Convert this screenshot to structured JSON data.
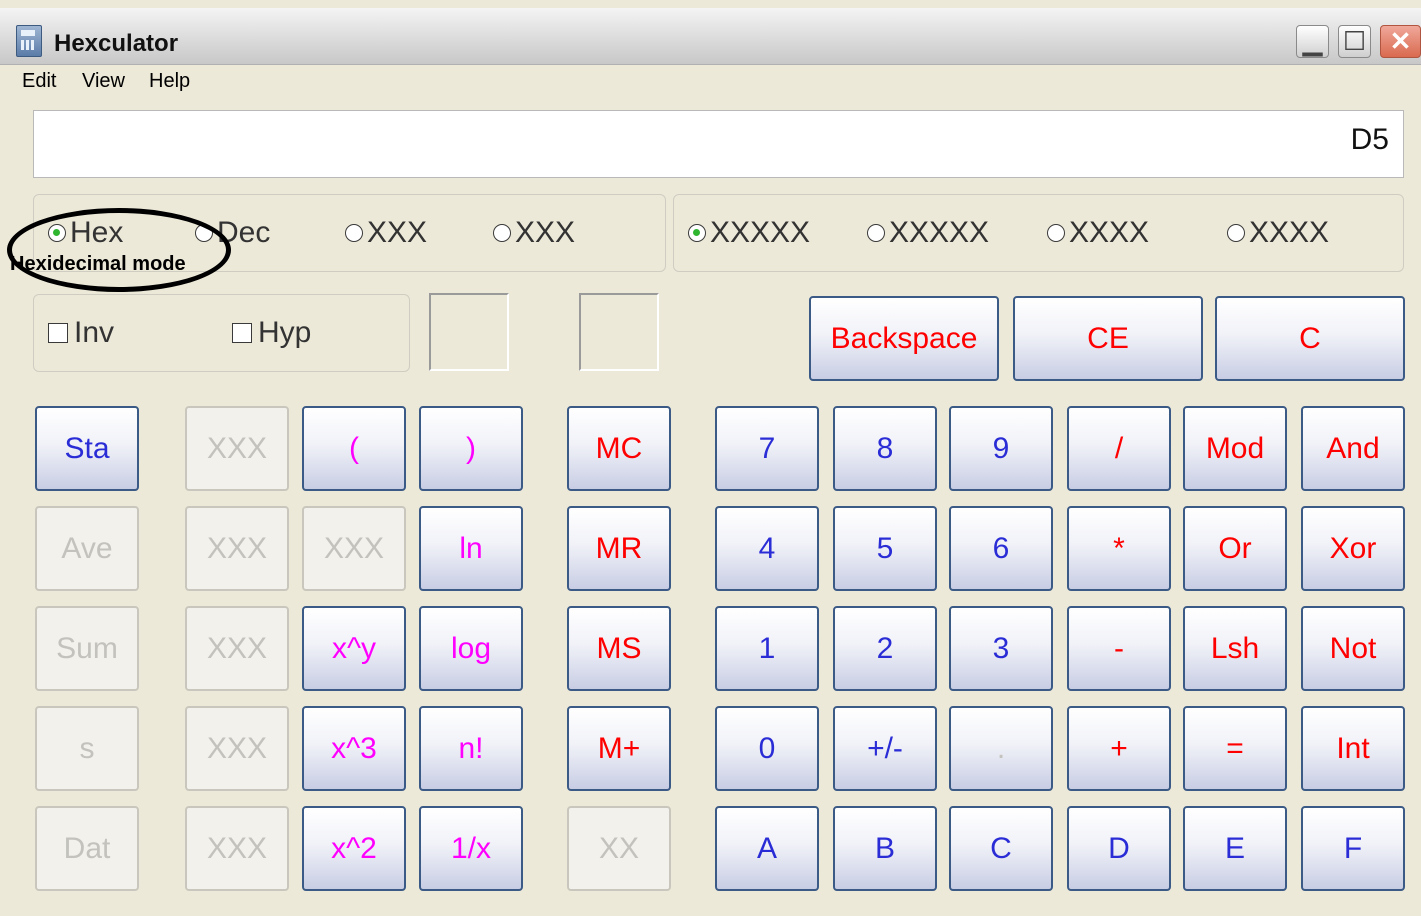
{
  "window": {
    "title": "Hexculator"
  },
  "menu": [
    "Edit",
    "View",
    "Help"
  ],
  "display": {
    "value": "D5"
  },
  "number_system": [
    {
      "label": "Hex",
      "selected": true
    },
    {
      "label": "Dec",
      "selected": false
    },
    {
      "label": "XXX",
      "selected": false
    },
    {
      "label": "XXX",
      "selected": false
    }
  ],
  "word_size": [
    {
      "label": "XXXXX",
      "selected": true
    },
    {
      "label": "XXXXX",
      "selected": false
    },
    {
      "label": "XXXX",
      "selected": false
    },
    {
      "label": "XXXX",
      "selected": false
    }
  ],
  "checkboxes": [
    {
      "label": "Inv",
      "checked": false
    },
    {
      "label": "Hyp",
      "checked": false
    }
  ],
  "annotation": {
    "text": "Hexidecimal mode"
  },
  "clear_buttons": [
    {
      "label": "Backspace",
      "color": "#ff0000"
    },
    {
      "label": "CE",
      "color": "#ff0000"
    },
    {
      "label": "C",
      "color": "#ff0000"
    }
  ],
  "keypad_rows": [
    [
      {
        "label": "Sta",
        "color": "#2a2cd6",
        "enabled": true
      },
      {
        "label": "XXX",
        "enabled": false
      },
      {
        "label": "(",
        "color": "#ff00ff",
        "enabled": true
      },
      {
        "label": ")",
        "color": "#ff00ff",
        "enabled": true
      },
      {
        "label": "MC",
        "color": "#ff0000",
        "enabled": true
      },
      {
        "label": "7",
        "color": "#2a2cd6",
        "enabled": true
      },
      {
        "label": "8",
        "color": "#2a2cd6",
        "enabled": true
      },
      {
        "label": "9",
        "color": "#2a2cd6",
        "enabled": true
      },
      {
        "label": "/",
        "color": "#ff0000",
        "enabled": true
      },
      {
        "label": "Mod",
        "color": "#ff0000",
        "enabled": true
      },
      {
        "label": "And",
        "color": "#ff0000",
        "enabled": true
      }
    ],
    [
      {
        "label": "Ave",
        "enabled": false
      },
      {
        "label": "XXX",
        "enabled": false
      },
      {
        "label": "XXX",
        "enabled": false
      },
      {
        "label": "ln",
        "color": "#ff00ff",
        "enabled": true
      },
      {
        "label": "MR",
        "color": "#ff0000",
        "enabled": true
      },
      {
        "label": "4",
        "color": "#2a2cd6",
        "enabled": true
      },
      {
        "label": "5",
        "color": "#2a2cd6",
        "enabled": true
      },
      {
        "label": "6",
        "color": "#2a2cd6",
        "enabled": true
      },
      {
        "label": "*",
        "color": "#ff0000",
        "enabled": true
      },
      {
        "label": "Or",
        "color": "#ff0000",
        "enabled": true
      },
      {
        "label": "Xor",
        "color": "#ff0000",
        "enabled": true
      }
    ],
    [
      {
        "label": "Sum",
        "enabled": false
      },
      {
        "label": "XXX",
        "enabled": false
      },
      {
        "label": "x^y",
        "color": "#ff00ff",
        "enabled": true
      },
      {
        "label": "log",
        "color": "#ff00ff",
        "enabled": true
      },
      {
        "label": "MS",
        "color": "#ff0000",
        "enabled": true
      },
      {
        "label": "1",
        "color": "#2a2cd6",
        "enabled": true
      },
      {
        "label": "2",
        "color": "#2a2cd6",
        "enabled": true
      },
      {
        "label": "3",
        "color": "#2a2cd6",
        "enabled": true
      },
      {
        "label": "-",
        "color": "#ff0000",
        "enabled": true
      },
      {
        "label": "Lsh",
        "color": "#ff0000",
        "enabled": true
      },
      {
        "label": "Not",
        "color": "#ff0000",
        "enabled": true
      }
    ],
    [
      {
        "label": "s",
        "enabled": false
      },
      {
        "label": "XXX",
        "enabled": false
      },
      {
        "label": "x^3",
        "color": "#ff00ff",
        "enabled": true
      },
      {
        "label": "n!",
        "color": "#ff00ff",
        "enabled": true
      },
      {
        "label": "M+",
        "color": "#ff0000",
        "enabled": true
      },
      {
        "label": "0",
        "color": "#2a2cd6",
        "enabled": true
      },
      {
        "label": "+/-",
        "color": "#2a2cd6",
        "enabled": true
      },
      {
        "label": ".",
        "color": "#c3c2bc",
        "enabled": true
      },
      {
        "label": "+",
        "color": "#ff0000",
        "enabled": true
      },
      {
        "label": "=",
        "color": "#ff0000",
        "enabled": true
      },
      {
        "label": "Int",
        "color": "#ff0000",
        "enabled": true
      }
    ],
    [
      {
        "label": "Dat",
        "enabled": false
      },
      {
        "label": "XXX",
        "enabled": false
      },
      {
        "label": "x^2",
        "color": "#ff00ff",
        "enabled": true
      },
      {
        "label": "1/x",
        "color": "#ff00ff",
        "enabled": true
      },
      {
        "label": "XX",
        "enabled": false
      },
      {
        "label": "A",
        "color": "#2a2cd6",
        "enabled": true
      },
      {
        "label": "B",
        "color": "#2a2cd6",
        "enabled": true
      },
      {
        "label": "C",
        "color": "#2a2cd6",
        "enabled": true
      },
      {
        "label": "D",
        "color": "#2a2cd6",
        "enabled": true
      },
      {
        "label": "E",
        "color": "#2a2cd6",
        "enabled": true
      },
      {
        "label": "F",
        "color": "#2a2cd6",
        "enabled": true
      }
    ]
  ]
}
